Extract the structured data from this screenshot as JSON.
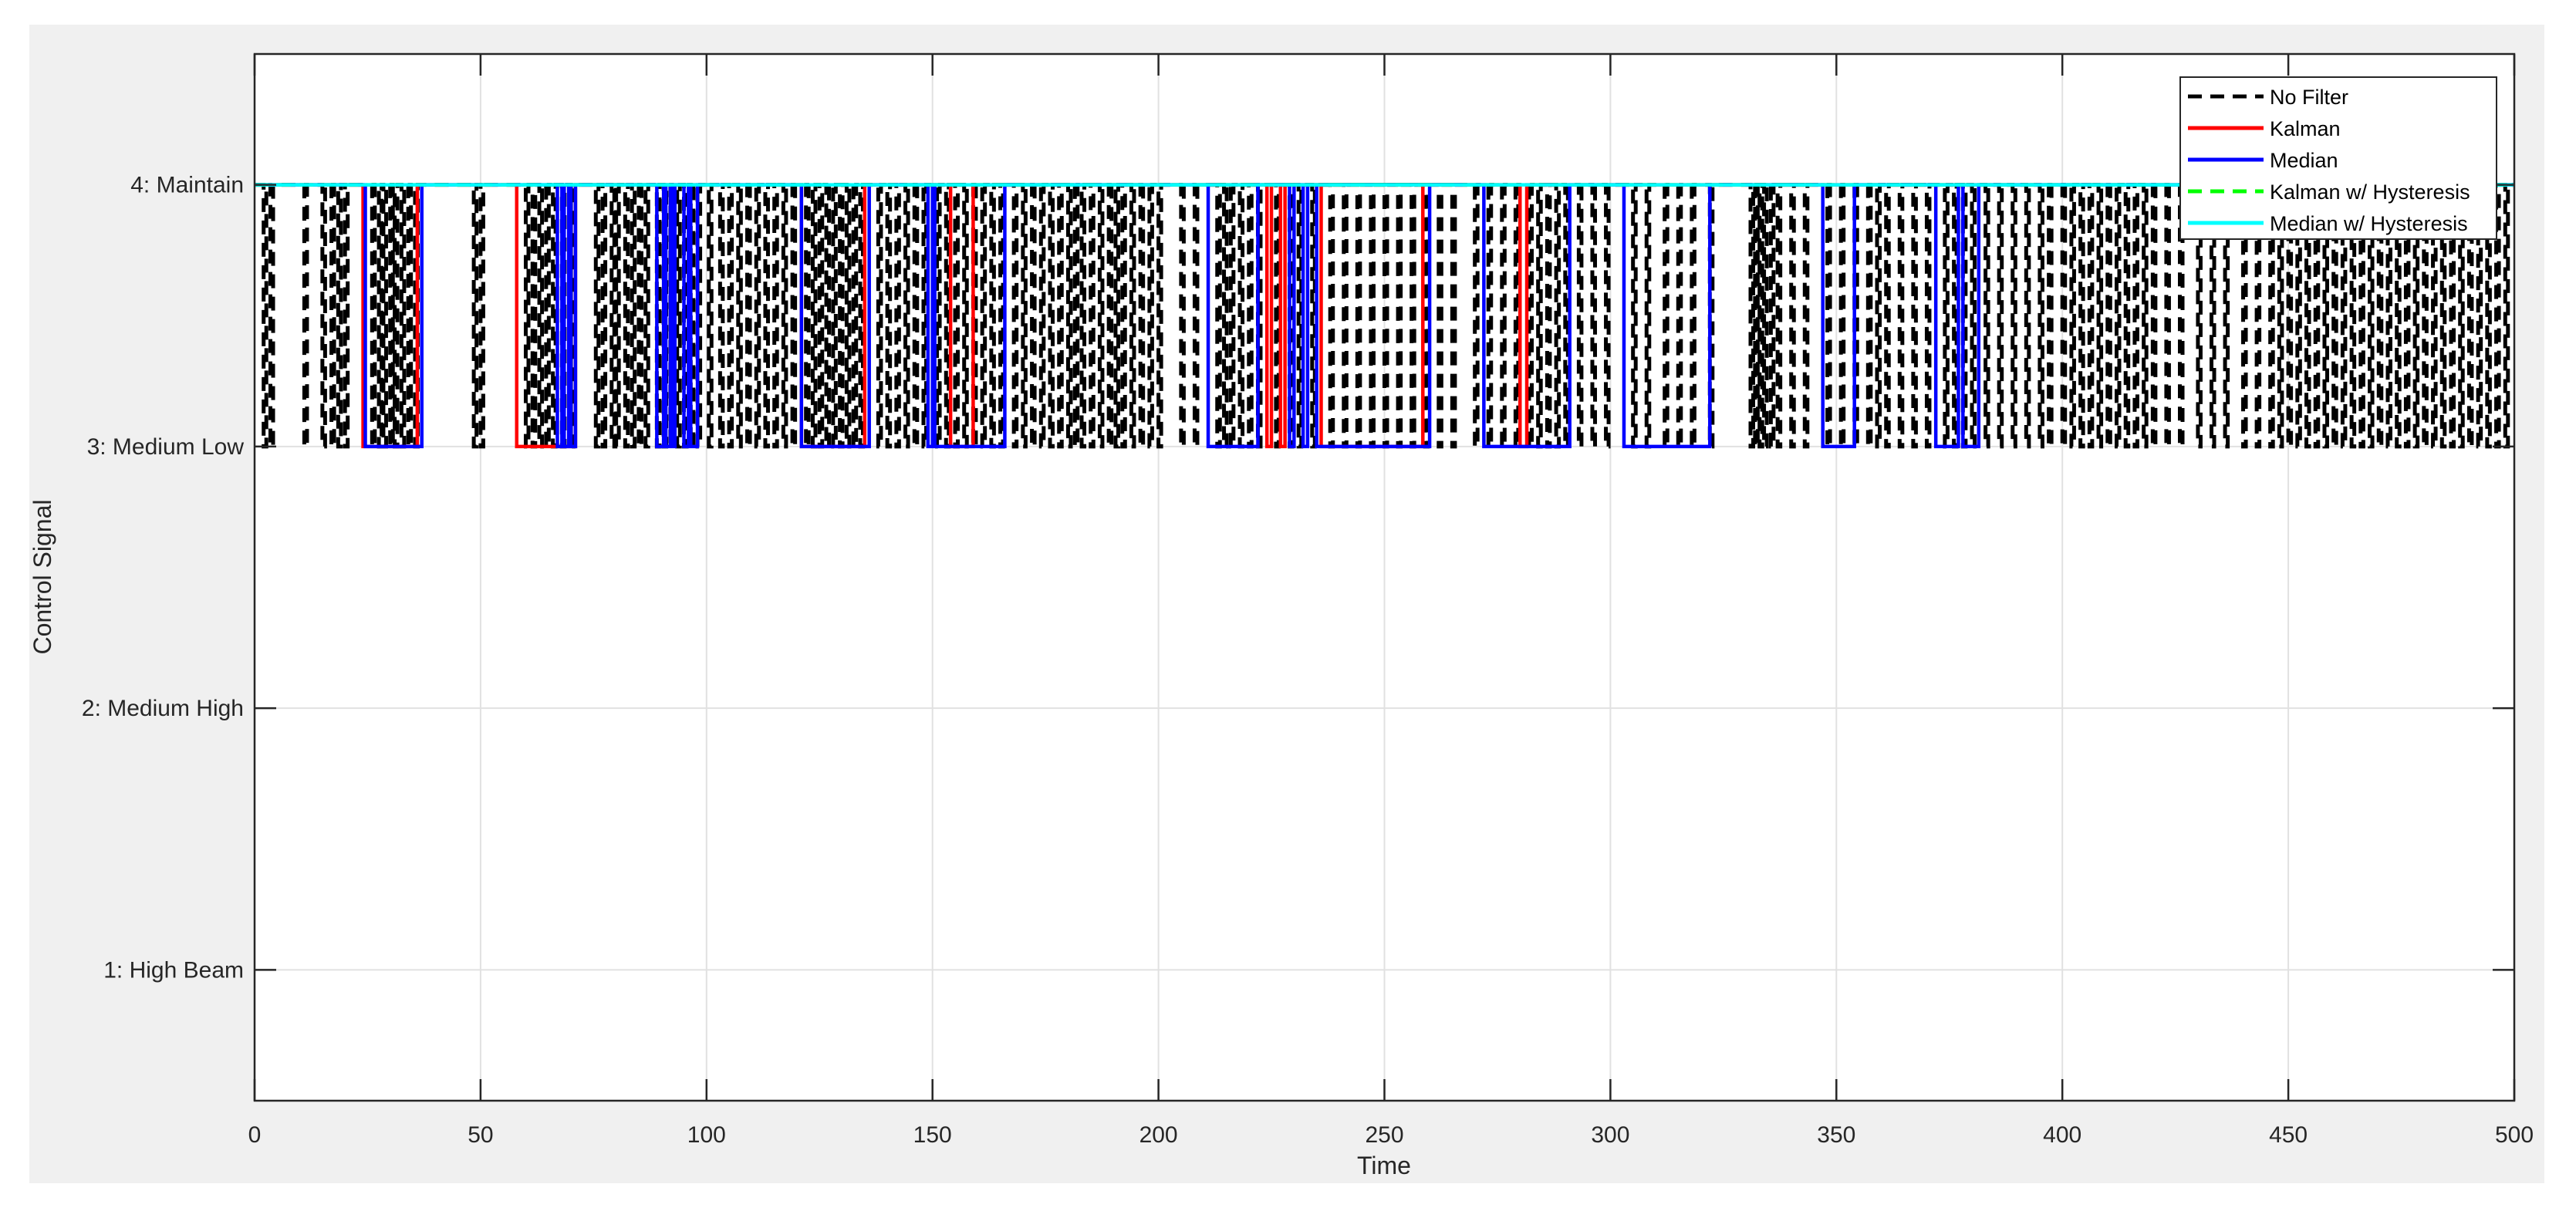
{
  "chart_data": {
    "type": "line",
    "title": "",
    "xlabel": "Time",
    "ylabel": "Control Signal",
    "xlim": [
      0,
      500
    ],
    "ylim": [
      0.5,
      4.5
    ],
    "grid": true,
    "legend_position": "top-right",
    "x_ticks": [
      0,
      50,
      100,
      150,
      200,
      250,
      300,
      350,
      400,
      450,
      500
    ],
    "x_tick_labels": [
      "0",
      "50",
      "100",
      "150",
      "200",
      "250",
      "300",
      "350",
      "400",
      "450",
      "500"
    ],
    "y_ticks": [
      1,
      2,
      3,
      4
    ],
    "y_tick_labels": [
      "1: High Beam",
      "2: Medium High",
      "3: Medium Low",
      "4: Maintain"
    ],
    "series": [
      {
        "name": "No Filter",
        "color": "#000000",
        "style": "dashed",
        "base_value": 4,
        "low_value": 3,
        "low_pulse_duration": 0.6,
        "low_pulse_starts": [
          2,
          3.5,
          11,
          15,
          17,
          18.5,
          20,
          26,
          27.5,
          28.5,
          30,
          31,
          32.5,
          34,
          35.5,
          48.5,
          50,
          60,
          61.5,
          63,
          64.5,
          66,
          68,
          70,
          75.5,
          77,
          79,
          80,
          82,
          83.5,
          85,
          86.5,
          89,
          90.5,
          92,
          93.5,
          95,
          96.5,
          98,
          100.5,
          103,
          105,
          107,
          109,
          111,
          113,
          115,
          117,
          119,
          122,
          123.5,
          125,
          126.5,
          128,
          129.5,
          131,
          132.5,
          134,
          138,
          140,
          142,
          144,
          146,
          148,
          151,
          153,
          155,
          157,
          159,
          161,
          163,
          165,
          168,
          170,
          172,
          174,
          176,
          178,
          180,
          181.5,
          183,
          185,
          187,
          189,
          190.5,
          192,
          194,
          196,
          198,
          200,
          205,
          208,
          213,
          214.5,
          216,
          218,
          220,
          222,
          226,
          229,
          231,
          234,
          238,
          241,
          244,
          247,
          250,
          253,
          256,
          259,
          262,
          265,
          270,
          273,
          276,
          279,
          282,
          284,
          286,
          288,
          290,
          293,
          296,
          299,
          305,
          308,
          312,
          315,
          318,
          322,
          331,
          332,
          333,
          334,
          335.5,
          337,
          340,
          343,
          348,
          351,
          354,
          357,
          359,
          361,
          364,
          367,
          370,
          374,
          376,
          378,
          380,
          383,
          386,
          389,
          392,
          395,
          397,
          400,
          402,
          404,
          406,
          408,
          410,
          412,
          414,
          416,
          418,
          420,
          423,
          426,
          430,
          433,
          436,
          440,
          443,
          446,
          448,
          450,
          452,
          454,
          456,
          458,
          460,
          462,
          464,
          466,
          468,
          470,
          472,
          474,
          476,
          478,
          480,
          482,
          484,
          486,
          488,
          490,
          492,
          494,
          496,
          498
        ]
      },
      {
        "name": "Kalman",
        "color": "#ff0000",
        "style": "solid",
        "base_value": 4,
        "low_value": 3,
        "low_intervals": [
          [
            24,
            36
          ],
          [
            58,
            71
          ],
          [
            121,
            135
          ],
          [
            154,
            159
          ],
          [
            224,
            225
          ],
          [
            227,
            228
          ],
          [
            236,
            258.5
          ],
          [
            280,
            281.5
          ]
        ]
      },
      {
        "name": "Median",
        "color": "#0000ff",
        "style": "solid",
        "base_value": 4,
        "low_value": 3,
        "low_intervals": [
          [
            24.5,
            37
          ],
          [
            67,
            68
          ],
          [
            68.5,
            69.5
          ],
          [
            70,
            71
          ],
          [
            89,
            90.5
          ],
          [
            91,
            92
          ],
          [
            92.5,
            93
          ],
          [
            95,
            96
          ],
          [
            96.5,
            98
          ],
          [
            121,
            136
          ],
          [
            149,
            150
          ],
          [
            150.5,
            166
          ],
          [
            211,
            222
          ],
          [
            229,
            230
          ],
          [
            232,
            233
          ],
          [
            235,
            260
          ],
          [
            272,
            291
          ],
          [
            303,
            322
          ],
          [
            347,
            354
          ],
          [
            372,
            377
          ],
          [
            378,
            381.5
          ]
        ]
      },
      {
        "name": "Kalman w/ Hysteresis",
        "color": "#00ff00",
        "style": "dashed",
        "base_value": 4,
        "low_value": 3,
        "low_intervals": []
      },
      {
        "name": "Median w/ Hysteresis",
        "color": "#00ffff",
        "style": "solid",
        "base_value": 4,
        "low_value": 3,
        "low_intervals": []
      }
    ]
  }
}
